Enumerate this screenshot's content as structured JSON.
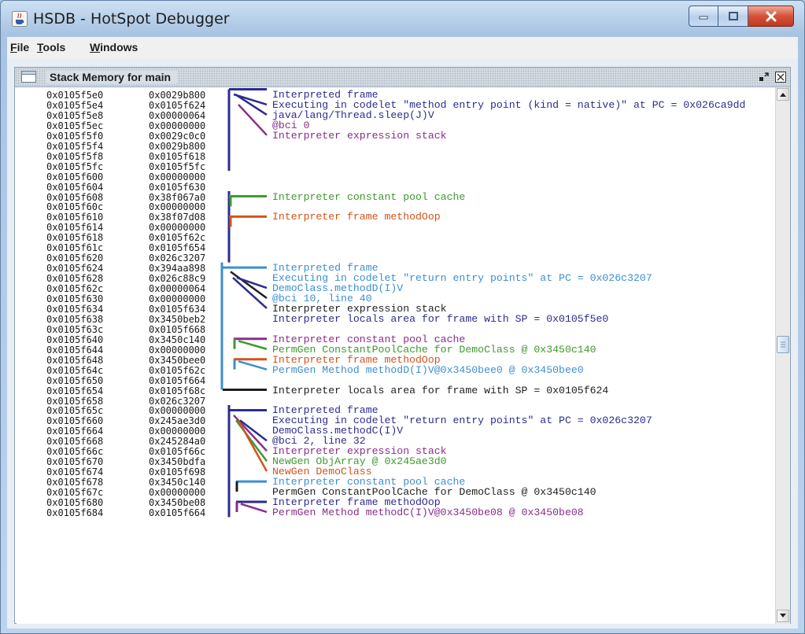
{
  "window": {
    "title": "HSDB - HotSpot Debugger"
  },
  "menu": [
    {
      "mnemonic": "F",
      "rest": "ile"
    },
    {
      "mnemonic": "T",
      "rest": "ools"
    },
    {
      "mnemonic": "W",
      "rest": "indows"
    }
  ],
  "panel": {
    "title": "Stack Memory for main"
  },
  "memory_rows": [
    [
      "0x0105f5e0",
      "0x0029b800"
    ],
    [
      "0x0105f5e4",
      "0x0105f624"
    ],
    [
      "0x0105f5e8",
      "0x00000064"
    ],
    [
      "0x0105f5ec",
      "0x00000000"
    ],
    [
      "0x0105f5f0",
      "0x0029c0c0"
    ],
    [
      "0x0105f5f4",
      "0x0029b800"
    ],
    [
      "0x0105f5f8",
      "0x0105f618"
    ],
    [
      "0x0105f5fc",
      "0x0105f5fc"
    ],
    [
      "0x0105f600",
      "0x00000000"
    ],
    [
      "0x0105f604",
      "0x0105f630"
    ],
    [
      "0x0105f608",
      "0x38f067a0"
    ],
    [
      "0x0105f60c",
      "0x00000000"
    ],
    [
      "0x0105f610",
      "0x38f07d08"
    ],
    [
      "0x0105f614",
      "0x00000000"
    ],
    [
      "0x0105f618",
      "0x0105f62c"
    ],
    [
      "0x0105f61c",
      "0x0105f654"
    ],
    [
      "0x0105f620",
      "0x026c3207"
    ],
    [
      "0x0105f624",
      "0x394aa898"
    ],
    [
      "0x0105f628",
      "0x026c88c9"
    ],
    [
      "0x0105f62c",
      "0x00000064"
    ],
    [
      "0x0105f630",
      "0x00000000"
    ],
    [
      "0x0105f634",
      "0x0105f634"
    ],
    [
      "0x0105f638",
      "0x3450beb2"
    ],
    [
      "0x0105f63c",
      "0x0105f668"
    ],
    [
      "0x0105f640",
      "0x3450c140"
    ],
    [
      "0x0105f644",
      "0x00000000"
    ],
    [
      "0x0105f648",
      "0x3450bee0"
    ],
    [
      "0x0105f64c",
      "0x0105f62c"
    ],
    [
      "0x0105f650",
      "0x0105f664"
    ],
    [
      "0x0105f654",
      "0x0105f68c"
    ],
    [
      "0x0105f658",
      "0x026c3207"
    ],
    [
      "0x0105f65c",
      "0x00000000"
    ],
    [
      "0x0105f660",
      "0x245ae3d0"
    ],
    [
      "0x0105f664",
      "0x00000000"
    ],
    [
      "0x0105f668",
      "0x245284a0"
    ],
    [
      "0x0105f66c",
      "0x0105f66c"
    ],
    [
      "0x0105f670",
      "0x3450bdfa"
    ],
    [
      "0x0105f674",
      "0x0105f698"
    ],
    [
      "0x0105f678",
      "0x3450c140"
    ],
    [
      "0x0105f67c",
      "0x00000000"
    ],
    [
      "0x0105f680",
      "0x3450be08"
    ],
    [
      "0x0105f684",
      "0x0105f664"
    ]
  ],
  "annotations": [
    {
      "text": "Interpreted frame",
      "color": "#2c2c8f"
    },
    {
      "text": "Executing in codelet \"method entry point (kind = native)\" at PC = 0x026ca9dd",
      "color": "#2c2c8f"
    },
    {
      "text": "java/lang/Thread.sleep(J)V",
      "color": "#2c2c8f"
    },
    {
      "text": "@bci 0",
      "color": "#8a2e8a"
    },
    {
      "text": "Interpreter expression stack",
      "color": "#8a2e8a"
    },
    {
      "text": "Interpreter constant pool cache",
      "color": "#3e9a2e"
    },
    {
      "text": "Interpreter frame methodOop",
      "color": "#d2541c"
    },
    {
      "text": "Interpreted frame",
      "color": "#3c8fd0"
    },
    {
      "text": "Executing in codelet \"return entry points\" at PC = 0x026c3207",
      "color": "#3c8fd0"
    },
    {
      "text": "DemoClass.methodD(I)V",
      "color": "#3c8fd0"
    },
    {
      "text": "@bci 10, line 40",
      "color": "#3c8fd0"
    },
    {
      "text": "Interpreter expression stack",
      "color": "#1e1e1e"
    },
    {
      "text": "Interpreter locals area for frame with SP = 0x0105f5e0",
      "color": "#2c2c8f"
    },
    {
      "text": "Interpreter constant pool cache",
      "color": "#8a2e8a"
    },
    {
      "text": "PermGen ConstantPoolCache for DemoClass @ 0x3450c140",
      "color": "#3e9a2e"
    },
    {
      "text": "Interpreter frame methodOop",
      "color": "#d2541c"
    },
    {
      "text": "PermGen Method methodD(I)V@0x3450bee0 @ 0x3450bee0",
      "color": "#3c8fd0"
    },
    {
      "text": "Interpreter locals area for frame with SP = 0x0105f624",
      "color": "#1e1e1e"
    },
    {
      "text": "Interpreted frame",
      "color": "#2c2c8f"
    },
    {
      "text": "Executing in codelet \"return entry points\" at PC = 0x026c3207",
      "color": "#2c2c8f"
    },
    {
      "text": "DemoClass.methodC(I)V",
      "color": "#2c2c8f"
    },
    {
      "text": "@bci 2, line 32",
      "color": "#2c2c8f"
    },
    {
      "text": "Interpreter expression stack",
      "color": "#8a2e8a"
    },
    {
      "text": "NewGen ObjArray @ 0x245ae3d0",
      "color": "#3e9a2e"
    },
    {
      "text": "NewGen DemoClass",
      "color": "#d2541c"
    },
    {
      "text": "Interpreter constant pool cache",
      "color": "#3c8fd0"
    },
    {
      "text": "PermGen ConstantPoolCache for DemoClass @ 0x3450c140",
      "color": "#1e1e1e"
    },
    {
      "text": "Interpreter frame methodOop",
      "color": "#2c2c8f"
    },
    {
      "text": "PermGen Method methodC(I)V@0x3450be08 @ 0x3450be08",
      "color": "#8a2e8a"
    }
  ]
}
